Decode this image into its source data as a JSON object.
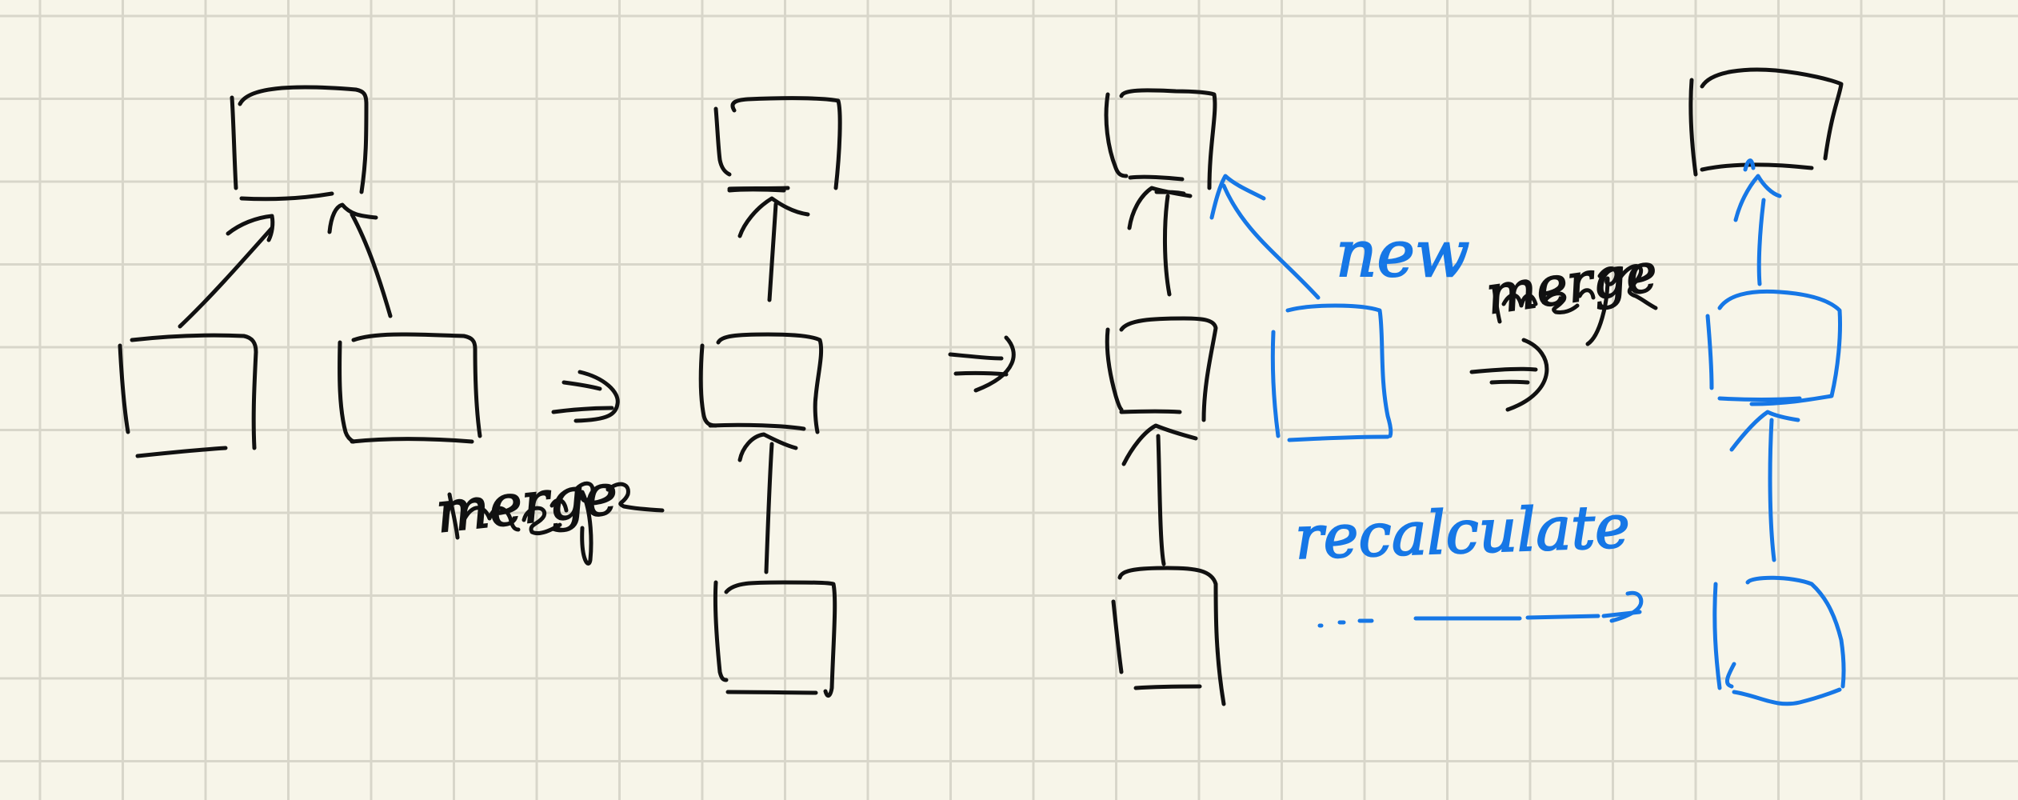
{
  "colors": {
    "paper": "#f7f5e9",
    "grid": "#d8d6ca",
    "ink_black": "#111111",
    "ink_blue": "#1677e6"
  },
  "labels": {
    "merge_1": "merge",
    "merge_2": "merge",
    "new": "new",
    "recalculate": "recalculate"
  }
}
